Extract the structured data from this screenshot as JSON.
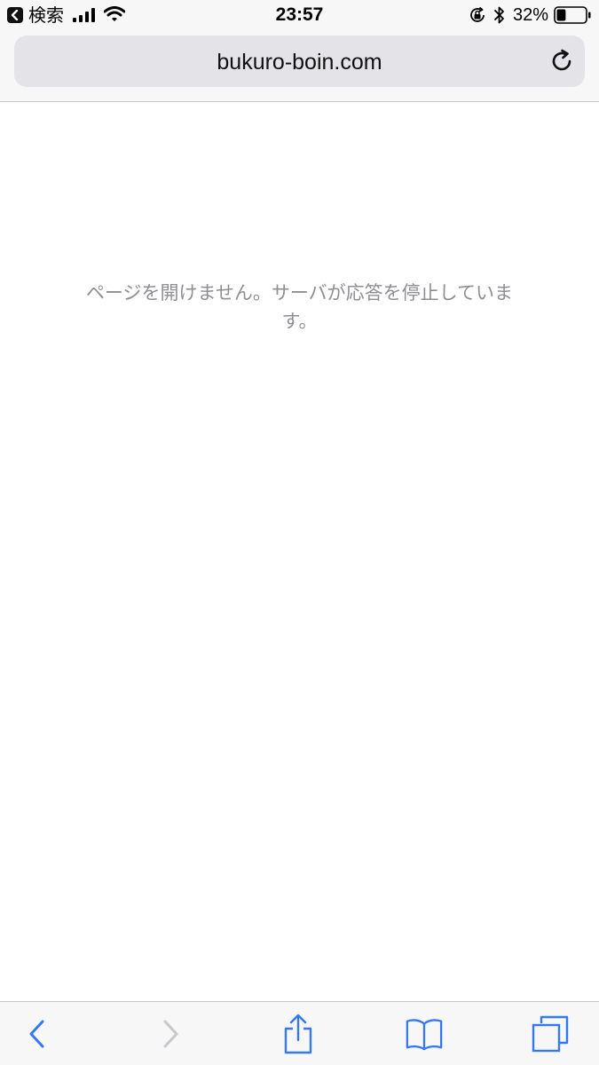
{
  "status_bar": {
    "back_label": "検索",
    "time": "23:57",
    "battery_percent": "32%",
    "battery_level": 0.32,
    "icons": [
      "back-chevron-icon",
      "signal-icon",
      "wifi-icon",
      "orientation-lock-icon",
      "bluetooth-icon",
      "battery-icon"
    ]
  },
  "url_bar": {
    "url": "bukuro-boin.com",
    "reload_icon": "reload-icon"
  },
  "content": {
    "error_message": "ページを開けません。サーバが応答を停止しています。"
  },
  "toolbar": {
    "icons": [
      "back-icon",
      "forward-icon",
      "share-icon",
      "bookmarks-icon",
      "tabs-icon"
    ],
    "accent_color": "#3478f6",
    "disabled_color": "#c7c7cc"
  }
}
